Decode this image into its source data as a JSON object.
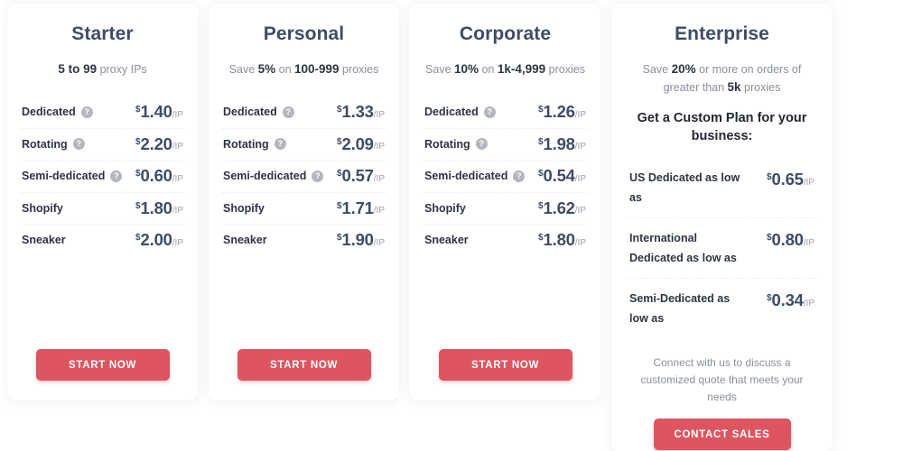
{
  "theme": {
    "title_color": "#3e4c67",
    "price_color": "#3e4c67",
    "accent_color": "#dd5560",
    "muted_color": "#8a8f99",
    "card_bg": "#ffffff"
  },
  "icons": {
    "help": "?",
    "help_name": "help-circle-icon"
  },
  "plans": [
    {
      "id": "starter",
      "title": "Starter",
      "subtitle_parts": [
        {
          "text": "5 to 99",
          "bold": true
        },
        {
          "text": " proxy IPs",
          "bold": false
        }
      ],
      "rows": [
        {
          "label": "Dedicated",
          "help": true,
          "currency": "$",
          "amount": "1.40",
          "unit": "/IP"
        },
        {
          "label": "Rotating",
          "help": true,
          "currency": "$",
          "amount": "2.20",
          "unit": "/IP"
        },
        {
          "label": "Semi-dedicated",
          "help": true,
          "currency": "$",
          "amount": "0.60",
          "unit": "/IP"
        },
        {
          "label": "Shopify",
          "help": false,
          "currency": "$",
          "amount": "1.80",
          "unit": "/IP"
        },
        {
          "label": "Sneaker",
          "help": false,
          "currency": "$",
          "amount": "2.00",
          "unit": "/IP"
        }
      ],
      "cta": "START NOW"
    },
    {
      "id": "personal",
      "title": "Personal",
      "subtitle_parts": [
        {
          "text": "Save ",
          "bold": false
        },
        {
          "text": "5%",
          "bold": true
        },
        {
          "text": " on ",
          "bold": false
        },
        {
          "text": "100-999",
          "bold": true
        },
        {
          "text": " proxies",
          "bold": false
        }
      ],
      "rows": [
        {
          "label": "Dedicated",
          "help": true,
          "currency": "$",
          "amount": "1.33",
          "unit": "/IP"
        },
        {
          "label": "Rotating",
          "help": true,
          "currency": "$",
          "amount": "2.09",
          "unit": "/IP"
        },
        {
          "label": "Semi-dedicated",
          "help": true,
          "currency": "$",
          "amount": "0.57",
          "unit": "/IP"
        },
        {
          "label": "Shopify",
          "help": false,
          "currency": "$",
          "amount": "1.71",
          "unit": "/IP"
        },
        {
          "label": "Sneaker",
          "help": false,
          "currency": "$",
          "amount": "1.90",
          "unit": "/IP"
        }
      ],
      "cta": "START NOW"
    },
    {
      "id": "corporate",
      "title": "Corporate",
      "subtitle_parts": [
        {
          "text": "Save ",
          "bold": false
        },
        {
          "text": "10%",
          "bold": true
        },
        {
          "text": " on ",
          "bold": false
        },
        {
          "text": "1k-4,999",
          "bold": true
        },
        {
          "text": " proxies",
          "bold": false
        }
      ],
      "rows": [
        {
          "label": "Dedicated",
          "help": true,
          "currency": "$",
          "amount": "1.26",
          "unit": "/IP"
        },
        {
          "label": "Rotating",
          "help": true,
          "currency": "$",
          "amount": "1.98",
          "unit": "/IP"
        },
        {
          "label": "Semi-dedicated",
          "help": true,
          "currency": "$",
          "amount": "0.54",
          "unit": "/IP"
        },
        {
          "label": "Shopify",
          "help": false,
          "currency": "$",
          "amount": "1.62",
          "unit": "/IP"
        },
        {
          "label": "Sneaker",
          "help": false,
          "currency": "$",
          "amount": "1.80",
          "unit": "/IP"
        }
      ],
      "cta": "START NOW"
    },
    {
      "id": "enterprise",
      "title": "Enterprise",
      "subtitle_parts": [
        {
          "text": "Save ",
          "bold": false
        },
        {
          "text": "20%",
          "bold": true
        },
        {
          "text": " or more on orders of greater than ",
          "bold": false
        },
        {
          "text": "5k",
          "bold": true
        },
        {
          "text": " proxies",
          "bold": false
        }
      ],
      "custom_heading": "Get a Custom Plan for your business:",
      "rows": [
        {
          "label": "US Dedicated as low as",
          "help": false,
          "currency": "$",
          "amount": "0.65",
          "unit": "/IP"
        },
        {
          "label": "International Dedicated as low as",
          "help": false,
          "currency": "$",
          "amount": "0.80",
          "unit": "/IP"
        },
        {
          "label": "Semi-Dedicated as low as",
          "help": false,
          "currency": "$",
          "amount": "0.34",
          "unit": "/IP"
        }
      ],
      "connect_note": "Connect with us to discuss a customized quote that meets your needs",
      "cta": "CONTACT SALES"
    }
  ]
}
